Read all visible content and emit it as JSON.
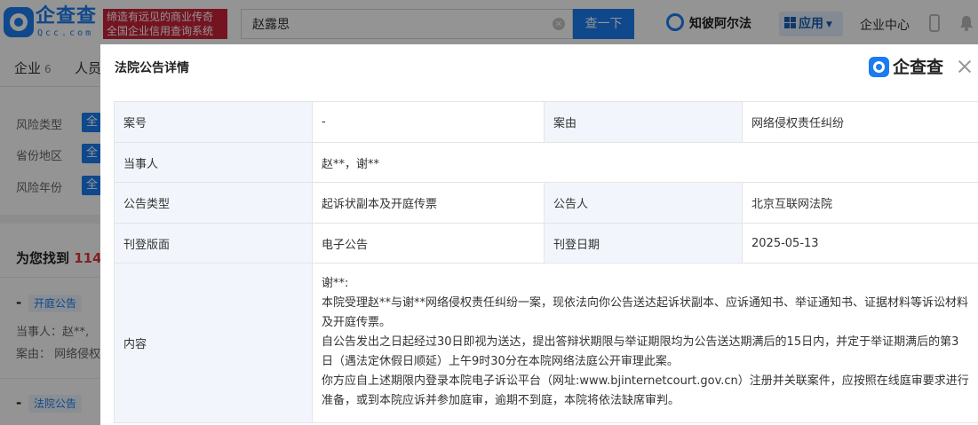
{
  "header": {
    "logo_text": "企查查",
    "logo_sub": "Qcc.com",
    "slogan_line1": "缔造有远见的商业传奇",
    "slogan_line2": "全国企业信用查询系统",
    "search_value": "赵露思",
    "clear_icon": "×",
    "search_button": "查一下",
    "zhibi_label": "知彼阿尔法",
    "apps_label": "应用",
    "enterprise_center": "企业中心"
  },
  "background": {
    "tabs": [
      {
        "label": "企业",
        "count": "6"
      },
      {
        "label": "人员",
        "count": ""
      }
    ],
    "filters": [
      {
        "label": "风险类型",
        "all": "全"
      },
      {
        "label": "省份地区",
        "all": "全"
      },
      {
        "label": "风险年份",
        "all": "全"
      }
    ],
    "found_prefix": "为您找到",
    "found_count": "114",
    "results": [
      {
        "dash": "-",
        "tag": "开庭公告",
        "line1": "当事人：赵**,",
        "line2": "案由：  网络侵权"
      },
      {
        "dash": "-",
        "tag": "法院公告",
        "line1": "",
        "line2": ""
      }
    ]
  },
  "modal": {
    "title": "法院公告详情",
    "logo_text": "企查查",
    "rows": {
      "case_no_label": "案号",
      "case_no_value": "-",
      "cause_label": "案由",
      "cause_value": "网络侵权责任纠纷",
      "party_label": "当事人",
      "party_value": "赵**，谢**",
      "type_label": "公告类型",
      "type_value": "起诉状副本及开庭传票",
      "announcer_label": "公告人",
      "announcer_value": "北京互联网法院",
      "layout_label": "刊登版面",
      "layout_value": "电子公告",
      "date_label": "刊登日期",
      "date_value": "2025-05-13",
      "content_label": "内容",
      "content_head": "谢**:",
      "content_paragraphs": [
        "本院受理赵**与谢**网络侵权责任纠纷一案，现依法向你公告送达起诉状副本、应诉通知书、举证通知书、证据材料等诉讼材料及开庭传票。",
        "自公告发出之日起经过30日即视为送达，提出答辩状期限与举证期限均为公告送达期满后的15日内，并定于举证期满后的第3日（遇法定休假日顺延）上午9时30分在本院网络法庭公开审理此案。",
        "你方应自上述期限内登录本院电子诉讼平台（网址:www.bjinternetcourt.gov.cn）注册并关联案件，应按照在线庭审要求进行准备，或到本院应诉并参加庭审，逾期不到庭，本院将依法缺席审判。"
      ]
    }
  },
  "colors": {
    "brand_blue": "#1a7cf0",
    "slogan_red": "#c8243a",
    "label_bg": "#f2f6fc",
    "count_red": "#e03a3a"
  },
  "icons": [
    "logo-icon",
    "clear-icon",
    "zhibi-icon",
    "apps-icon",
    "chevron-down-icon",
    "phone-icon",
    "bell-icon",
    "modal-logo-icon",
    "close-icon"
  ]
}
